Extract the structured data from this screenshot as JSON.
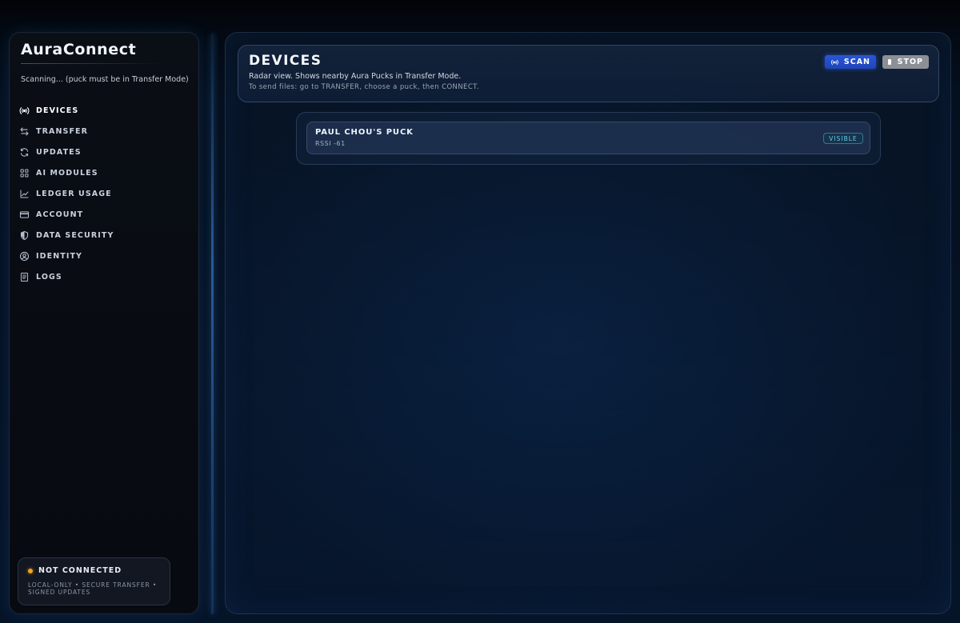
{
  "sidebar": {
    "brand": "AuraConnect",
    "scan_status": "Scanning... (puck must be in Transfer Mode)",
    "items": [
      {
        "label": "DEVICES",
        "icon": "radar-icon",
        "active": true
      },
      {
        "label": "TRANSFER",
        "icon": "swap-arrows-icon",
        "active": false
      },
      {
        "label": "UPDATES",
        "icon": "refresh-icon",
        "active": false
      },
      {
        "label": "AI MODULES",
        "icon": "grid-icon",
        "active": false
      },
      {
        "label": "LEDGER USAGE",
        "icon": "line-chart-icon",
        "active": false
      },
      {
        "label": "ACCOUNT",
        "icon": "card-icon",
        "active": false
      },
      {
        "label": "DATA SECURITY",
        "icon": "shield-icon",
        "active": false
      },
      {
        "label": "IDENTITY",
        "icon": "user-circle-icon",
        "active": false
      },
      {
        "label": "LOGS",
        "icon": "document-icon",
        "active": false
      }
    ],
    "connection": {
      "status": "NOT CONNECTED",
      "status_color": "#f3a21a",
      "detail": "LOCAL-ONLY • SECURE TRANSFER • SIGNED UPDATES"
    }
  },
  "main": {
    "title": "DEVICES",
    "subtitle": "Radar view. Shows nearby Aura Pucks in Transfer Mode.",
    "hint": "To send files: go to TRANSFER, choose a puck, then CONNECT.",
    "scan_label": "SCAN",
    "stop_label": "STOP",
    "devices": [
      {
        "name": "PAUL CHOU'S PUCK",
        "rssi": "RSSI -61",
        "badge": "VISIBLE"
      }
    ]
  },
  "colors": {
    "accent": "#2a56d8",
    "badge": "#5fd0e8",
    "warning": "#f3a21a"
  }
}
